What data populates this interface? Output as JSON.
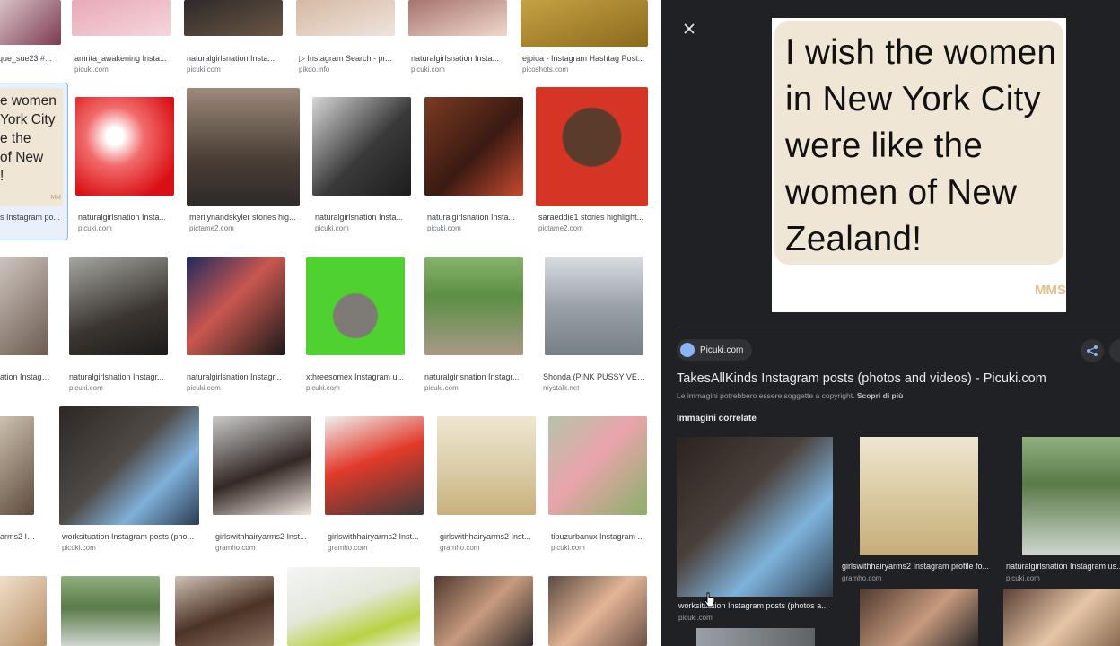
{
  "grid": {
    "row1": [
      {
        "caption": "que_sue23 #...",
        "source": ""
      },
      {
        "caption": "amrita_awakening Insta...",
        "source": "picuki.com"
      },
      {
        "caption": "naturalgirlsnation Insta...",
        "source": "picuki.com"
      },
      {
        "caption": "▷ Instagram Search - pr...",
        "source": "pikdo.info"
      },
      {
        "caption": "naturalgirlsnation Insta...",
        "source": "picuki.com"
      },
      {
        "caption": "ejpiua - Instagram Hashtag Post...",
        "source": "picoshots.com"
      }
    ],
    "row2": [
      {
        "caption": "s Instagram po...",
        "source": "",
        "thumb_text": "e women\nYork City\ne the\nof New\n!",
        "thumb_mark": "MM"
      },
      {
        "caption": "naturalgirlsnation Insta...",
        "source": "picuki.com"
      },
      {
        "caption": "merilynandskyler stories hig...",
        "source": "pictame2.com"
      },
      {
        "caption": "naturalgirlsnation Insta...",
        "source": "picuki.com"
      },
      {
        "caption": "naturalgirlsnation Insta...",
        "source": "picuki.com"
      },
      {
        "caption": "saraeddie1 stories highlight...",
        "source": "pictame2.com"
      }
    ],
    "row3": [
      {
        "caption": "ation Instagr...",
        "source": ""
      },
      {
        "caption": "naturalgirlsnation Instagr...",
        "source": "picuki.com"
      },
      {
        "caption": "naturalgirlsnation Instagr...",
        "source": "picuki.com"
      },
      {
        "caption": "xthreesomex Instagram u...",
        "source": "picuki.com"
      },
      {
        "caption": "naturalgirlsnation Instagr...",
        "source": "picuki.com"
      },
      {
        "caption": "Shonda (PINK PUSSY VEG...",
        "source": "mystalk.net"
      }
    ],
    "row4": [
      {
        "caption": "arms2 Inst...",
        "source": ""
      },
      {
        "caption": "worksituation Instagram posts (pho...",
        "source": "picuki.com"
      },
      {
        "caption": "girlswithhairyarms2 Inst...",
        "source": "gramho.com"
      },
      {
        "caption": "girlswithhairyarms2 Inst...",
        "source": "gramho.com"
      },
      {
        "caption": "girlswithhairyarms2 Inst...",
        "source": "gramho.com"
      },
      {
        "caption": "tipuzurbanux Instagram ...",
        "source": "picuki.com"
      }
    ]
  },
  "panel": {
    "close_icon": "close-icon",
    "preview_text": "I wish the women in New York City were like the women of New Zealand!",
    "preview_mark": "MMS",
    "source_chip": "Picuki.com",
    "title": "TakesAllKinds Instagram posts (photos and videos) - Picuki.com",
    "copyright": "Le immagini potrebbero essere soggette a copyright.",
    "learn_more": "Scopri di più",
    "related_heading": "Immagini correlate",
    "related": [
      {
        "caption": "worksituation Instagram posts (photos a...",
        "source": "picuki.com"
      },
      {
        "caption": "girlswithhairyarms2 Instagram profile fo...",
        "source": "gramho.com"
      },
      {
        "caption": "naturalgirlsnation Instagram us...",
        "source": "picuki.com"
      }
    ]
  },
  "colors": {
    "panel_bg": "#202124",
    "chip_bg": "#303134",
    "accent": "#8ab4f8",
    "selection_bg": "#e8f0fe"
  }
}
